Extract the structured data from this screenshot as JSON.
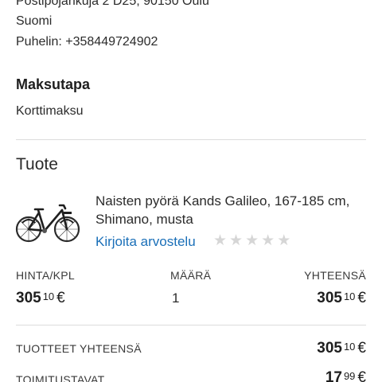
{
  "address": {
    "street": "Postipojankuja 2 D25, 90150 Oulu",
    "country": "Suomi",
    "phone": "Puhelin: +358449724902"
  },
  "payment": {
    "title": "Maksutapa",
    "method": "Korttimaksu"
  },
  "product_section": {
    "heading": "Tuote",
    "product": {
      "name": "Naisten pyörä Kands Galileo, 167-185 cm, Shimano, musta",
      "image_icon": "bicycle-icon",
      "review_link": "Kirjoita arvostelu",
      "rating_stars": 5,
      "rating_value": 0
    },
    "columns": {
      "unit_price": "HINTA/KPL",
      "quantity": "MÄÄRÄ",
      "total": "YHTEENSÄ"
    },
    "unit_price": {
      "main": "305",
      "cents": "10",
      "currency": "€"
    },
    "quantity": "1",
    "line_total": {
      "main": "305",
      "cents": "10",
      "currency": "€"
    }
  },
  "summary": {
    "products_total_label": "TUOTTEET YHTEENSÄ",
    "products_total": {
      "main": "305",
      "cents": "10",
      "currency": "€"
    },
    "shipping_label": "TOIMITUSTAVAT",
    "shipping": {
      "main": "17",
      "cents": "99",
      "currency": "€"
    }
  },
  "colors": {
    "link": "#1a6fb8",
    "star_empty": "#d6d6d6",
    "divider": "#dcdcdc"
  }
}
